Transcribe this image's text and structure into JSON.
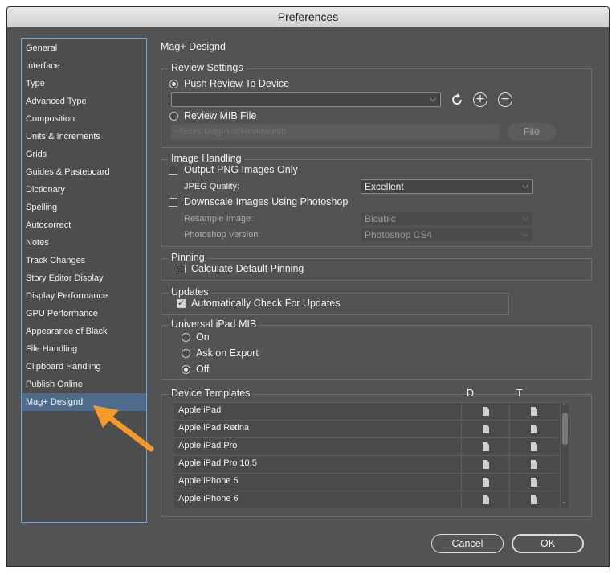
{
  "window": {
    "title": "Preferences"
  },
  "sidebar": {
    "items": [
      {
        "label": "General"
      },
      {
        "label": "Interface"
      },
      {
        "label": "Type"
      },
      {
        "label": "Advanced Type"
      },
      {
        "label": "Composition"
      },
      {
        "label": "Units & Increments"
      },
      {
        "label": "Grids"
      },
      {
        "label": "Guides & Pasteboard"
      },
      {
        "label": "Dictionary"
      },
      {
        "label": "Spelling"
      },
      {
        "label": "Autocorrect"
      },
      {
        "label": "Notes"
      },
      {
        "label": "Track Changes"
      },
      {
        "label": "Story Editor Display"
      },
      {
        "label": "Display Performance"
      },
      {
        "label": "GPU Performance"
      },
      {
        "label": "Appearance of Black"
      },
      {
        "label": "File Handling"
      },
      {
        "label": "Clipboard Handling"
      },
      {
        "label": "Publish Online"
      },
      {
        "label": "Mag+ Designd"
      }
    ],
    "selected": "Mag+ Designd"
  },
  "main": {
    "heading": "Mag+ Designd",
    "review_settings": {
      "title": "Review Settings",
      "push_label": "Push Review To Device",
      "push_selected": true,
      "device_dropdown_value": "",
      "mib_label": "Review MIB File",
      "mib_selected": false,
      "mib_path_placeholder": "~/Sites/MagPlus/Review.mib",
      "file_button": "File"
    },
    "image_handling": {
      "title": "Image Handling",
      "png_label": "Output PNG Images Only",
      "png_checked": false,
      "jpeg_label": "JPEG Quality:",
      "jpeg_value": "Excellent",
      "downscale_label": "Downscale Images Using Photoshop",
      "downscale_checked": false,
      "resample_label": "Resample Image:",
      "resample_value": "Bicubic",
      "ps_version_label": "Photoshop Version:",
      "ps_version_value": "Photoshop CS4"
    },
    "pinning": {
      "title": "Pinning",
      "calc_label": "Calculate Default Pinning",
      "calc_checked": false
    },
    "updates": {
      "title": "Updates",
      "auto_label": "Automatically Check For Updates",
      "auto_checked": true
    },
    "universal_ipad": {
      "title": "Universal iPad MIB",
      "options": [
        {
          "label": "On",
          "selected": false
        },
        {
          "label": "Ask on Export",
          "selected": false
        },
        {
          "label": "Off",
          "selected": true
        }
      ]
    },
    "device_templates": {
      "title": "Device Templates",
      "col_d": "D",
      "col_t": "T",
      "rows": [
        {
          "name": "Apple iPad"
        },
        {
          "name": "Apple iPad Retina"
        },
        {
          "name": "Apple iPad Pro"
        },
        {
          "name": "Apple iPad Pro 10.5"
        },
        {
          "name": "Apple iPhone 5"
        },
        {
          "name": "Apple iPhone 6"
        }
      ]
    }
  },
  "buttons": {
    "cancel": "Cancel",
    "ok": "OK"
  },
  "icons": {
    "refresh": "refresh-icon",
    "add": "plus-circle-icon",
    "remove": "minus-circle-icon",
    "document": "document-icon",
    "chevron": "chevron-down-icon"
  },
  "colors": {
    "dialog_bg": "#535353",
    "selection": "#4f6b8c",
    "sidebar_border": "#6aa6e0",
    "annotation_arrow": "#f39a2b"
  }
}
